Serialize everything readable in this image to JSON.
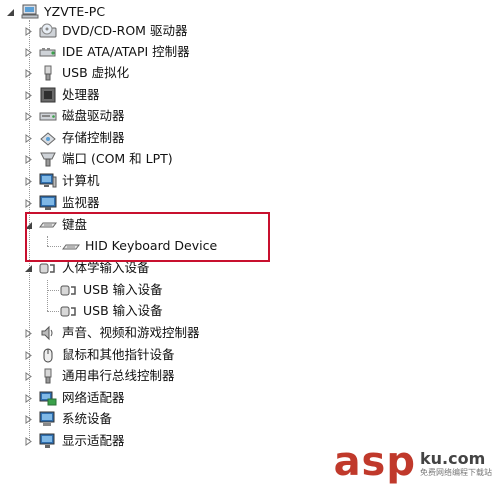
{
  "tree": {
    "root": {
      "label": "YZVTE-PC",
      "icon": "computer-icon",
      "expanded": true
    },
    "items": [
      {
        "label": "DVD/CD-ROM 驱动器",
        "icon": "dvd-drive-icon",
        "expanded": false
      },
      {
        "label": "IDE ATA/ATAPI 控制器",
        "icon": "ide-controller-icon",
        "expanded": false
      },
      {
        "label": "USB 虚拟化",
        "icon": "usb-icon",
        "expanded": false
      },
      {
        "label": "处理器",
        "icon": "processor-icon",
        "expanded": false
      },
      {
        "label": "磁盘驱动器",
        "icon": "disk-drive-icon",
        "expanded": false
      },
      {
        "label": "存储控制器",
        "icon": "storage-controller-icon",
        "expanded": false
      },
      {
        "label": "端口 (COM 和 LPT)",
        "icon": "port-icon",
        "expanded": false
      },
      {
        "label": "计算机",
        "icon": "computer-icon",
        "expanded": false
      },
      {
        "label": "监视器",
        "icon": "monitor-icon",
        "expanded": false
      },
      {
        "label": "键盘",
        "icon": "keyboard-icon",
        "expanded": true,
        "children": [
          {
            "label": "HID Keyboard Device",
            "icon": "keyboard-icon"
          }
        ]
      },
      {
        "label": "人体学输入设备",
        "icon": "hid-icon",
        "expanded": true,
        "children": [
          {
            "label": "USB 输入设备",
            "icon": "hid-icon"
          },
          {
            "label": "USB 输入设备",
            "icon": "hid-icon"
          }
        ]
      },
      {
        "label": "声音、视频和游戏控制器",
        "icon": "speaker-icon",
        "expanded": false
      },
      {
        "label": "鼠标和其他指针设备",
        "icon": "mouse-icon",
        "expanded": false
      },
      {
        "label": "通用串行总线控制器",
        "icon": "usb-icon",
        "expanded": false
      },
      {
        "label": "网络适配器",
        "icon": "network-adapter-icon",
        "expanded": false
      },
      {
        "label": "系统设备",
        "icon": "system-device-icon",
        "expanded": false
      },
      {
        "label": "显示适配器",
        "icon": "display-adapter-icon",
        "expanded": false
      }
    ]
  },
  "highlight": {
    "color": "#c8102e"
  },
  "watermark": {
    "main": "asp",
    "site": "ku.com",
    "slogan": "免费网络编程下载站"
  }
}
